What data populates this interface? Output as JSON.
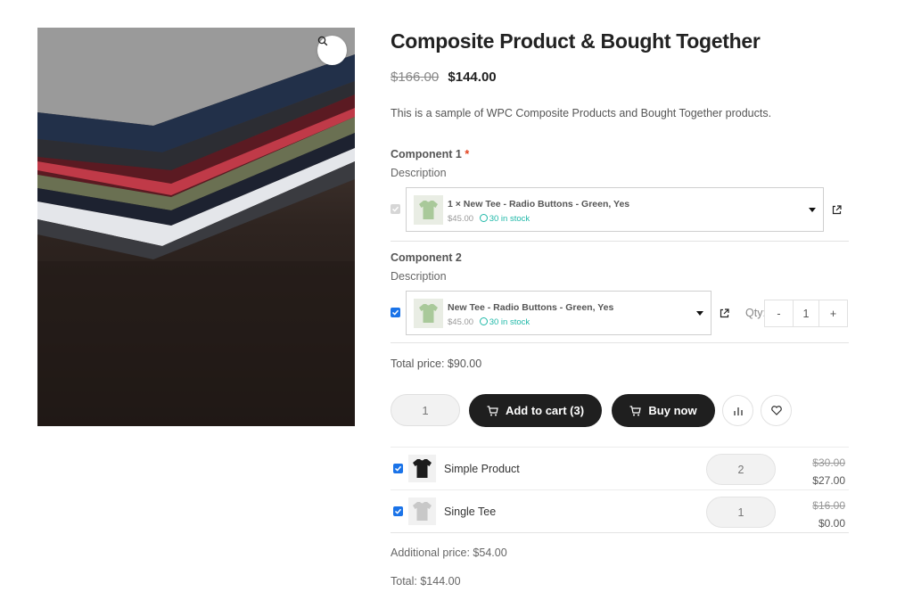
{
  "product": {
    "title": "Composite Product & Bought Together",
    "price_old": "$166.00",
    "price_new": "$144.00",
    "description": "This is a sample of WPC Composite Products and Bought Together products."
  },
  "components": [
    {
      "title": "Component 1",
      "required_mark": "*",
      "description": "Description",
      "selected_name": "1 × New Tee - Radio Buttons - Green, Yes",
      "price": "$45.00",
      "stock": "30 in stock",
      "checked": true,
      "disabled": true
    },
    {
      "title": "Component 2",
      "description": "Description",
      "selected_name": "New Tee - Radio Buttons - Green, Yes",
      "price": "$45.00",
      "stock": "30 in stock",
      "checked": true,
      "qty_label": "Qty:",
      "qty_minus": "-",
      "qty_value": "1",
      "qty_plus": "+"
    }
  ],
  "total_price": "Total price: $90.00",
  "cart": {
    "qty": "1",
    "add_to_cart_label": "Add to cart (3)",
    "buy_now_label": "Buy now"
  },
  "bought_together": [
    {
      "name": "Simple Product",
      "qty": "2",
      "price_old": "$30.00",
      "price_new": "$27.00",
      "shirt_color": "#1c1c1c"
    },
    {
      "name": "Single Tee",
      "qty": "1",
      "price_old": "$16.00",
      "price_new": "$0.00",
      "shirt_color": "#c8c8c8"
    }
  ],
  "additional_price": "Additional price: $54.00",
  "grand_total": "Total: $144.00",
  "colors": {
    "accent_button": "#1f1f1f",
    "checkbox": "#1a73e8",
    "stock": "#1fb8a8",
    "required": "#e2401c"
  },
  "icons": {
    "zoom": "magnifier-icon",
    "cart": "cart-icon",
    "compare": "bar-chart-icon",
    "wishlist": "heart-icon",
    "external_link": "external-link-icon"
  }
}
